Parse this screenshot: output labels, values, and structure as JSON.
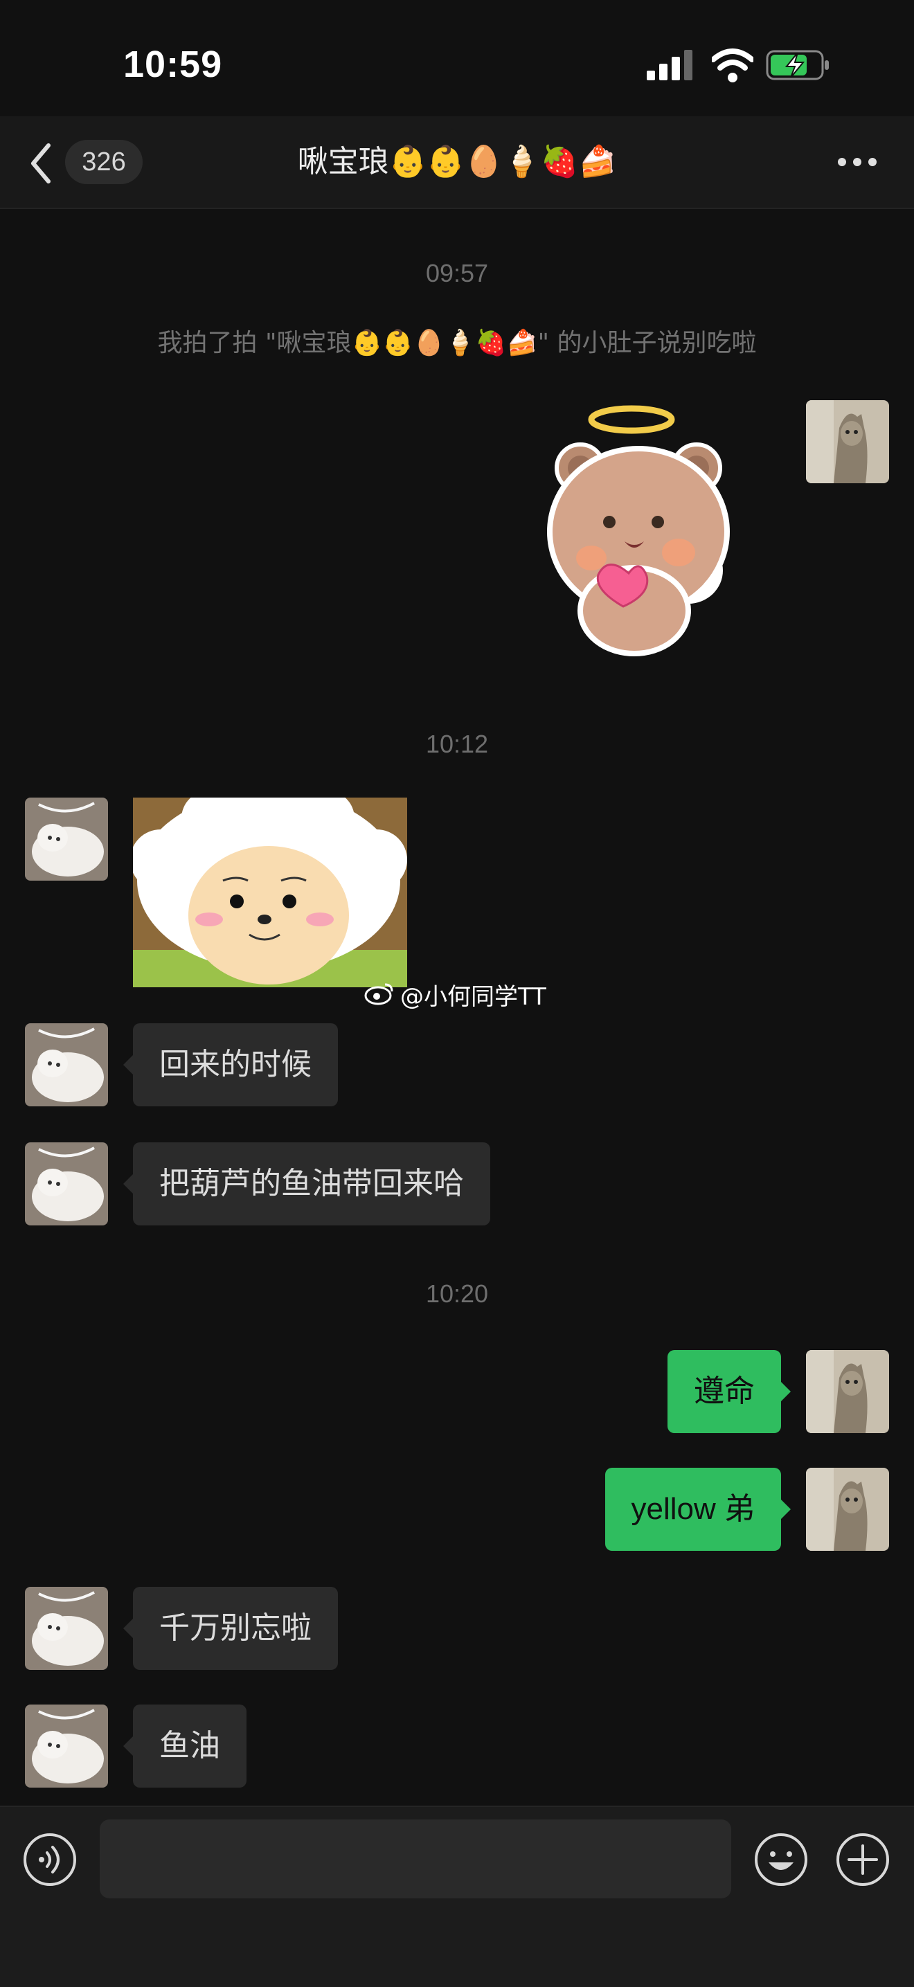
{
  "status_bar": {
    "time": "10:59"
  },
  "nav": {
    "unread_count": "326",
    "title": "啾宝琅👶👶🥚🍦🍓🍰"
  },
  "colors": {
    "outgoing_bubble": "#2fbd5f",
    "incoming_bubble": "#2b2b2b",
    "background": "#111111"
  },
  "timestamps": [
    "09:57",
    "10:12",
    "10:20"
  ],
  "system_message": "我拍了拍 \"啾宝琅👶👶🥚🍦🍓🍰\" 的小肚子说别吃啦",
  "messages": {
    "m1": {
      "side": "outgoing",
      "type": "sticker",
      "sticker": "angel-bear-holding-heart"
    },
    "m2": {
      "side": "incoming",
      "type": "image",
      "image": "cartoon-sheep-face",
      "watermark": "@小何同学TT"
    },
    "m3": {
      "side": "incoming",
      "text": "回来的时候"
    },
    "m4": {
      "side": "incoming",
      "text": "把葫芦的鱼油带回来哈"
    },
    "m5": {
      "side": "outgoing",
      "text": "遵命"
    },
    "m6": {
      "side": "outgoing",
      "text": "yellow 弟"
    },
    "m7": {
      "side": "incoming",
      "text": "千万别忘啦"
    },
    "m8": {
      "side": "incoming",
      "text": "鱼油"
    }
  },
  "input_bar": {
    "placeholder": ""
  },
  "icons": [
    "back-chevron-icon",
    "more-dots-icon",
    "voice-icon",
    "emoji-icon",
    "plus-icon",
    "signal-icon",
    "wifi-icon",
    "battery-charging-icon",
    "weibo-icon"
  ]
}
